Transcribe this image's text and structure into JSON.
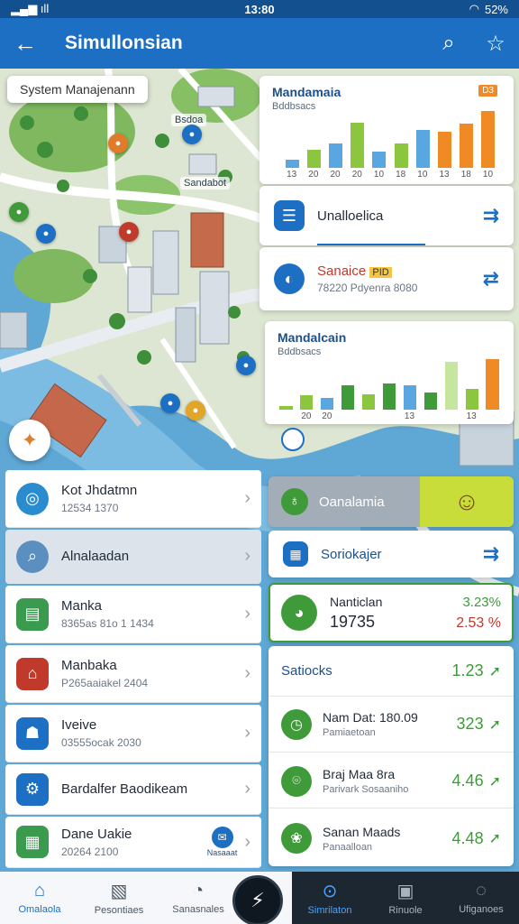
{
  "status": {
    "time": "13:80",
    "battery": "52%",
    "left_icons": "▂▄▆ ıll"
  },
  "appbar": {
    "title": "Simullonsian"
  },
  "map": {
    "tooltip": "System Manajenann",
    "labels": [
      "Bsdoa",
      "Sandabot"
    ]
  },
  "chart_top": {
    "title": "Mandamaia",
    "subtitle": "Bddbsacs",
    "badge": "D3"
  },
  "row_top_1": {
    "label": "Unalloelica"
  },
  "row_top_2": {
    "label": "Sanaice",
    "tag": "PID",
    "sub": "78220 Pdyenra 8080"
  },
  "chart_mid": {
    "title": "Mandalcain",
    "subtitle": "Bddbsacs"
  },
  "left_list": [
    {
      "title": "Kot Jhdatmn",
      "sub": "12534 1370",
      "color": "#2a8ccf",
      "icon": "◎"
    },
    {
      "title": "Alnalaadan",
      "sub": "",
      "color": "#5a8fbf",
      "icon": "⌕"
    },
    {
      "title": "Manka",
      "sub": "8365as 81o 1 1434",
      "color": "#3a9b4f",
      "icon": "▤"
    },
    {
      "title": "Manbaka",
      "sub": "P265aaiakel 2404",
      "color": "#c0392b",
      "icon": "⌂"
    },
    {
      "title": "Iveive",
      "sub": "03555ocak 2030",
      "color": "#1d6fc4",
      "icon": "☗"
    },
    {
      "title": "Bardalfer Baodikeam",
      "sub": "",
      "color": "#1d6fc4",
      "icon": "⚙"
    },
    {
      "title": "Dane Uakie",
      "sub": "20264 2100",
      "color": "#3a9b4f",
      "icon": "▦",
      "extra": "Nasaaat"
    }
  ],
  "right_panel": {
    "header": {
      "label": "Oanalamia"
    },
    "tab": {
      "label": "Soriokajer"
    },
    "summary": {
      "label": "Nanticlan",
      "value": "19735",
      "pct_green": "3.23%",
      "pct_red": "2.53 %"
    },
    "stats_title": "Satiocks",
    "stats_title_val": "1.23",
    "stats": [
      {
        "title": "Nam Dat: 180.09",
        "sub": "Pamiaetoan",
        "value": "323"
      },
      {
        "title": "Braj Maa 8ra",
        "sub": "Parivark Sosaaniho",
        "value": "4.46"
      },
      {
        "title": "Sanan Maads",
        "sub": "Panaalloan",
        "value": "4.48"
      }
    ]
  },
  "bottom_nav": [
    {
      "label": "Omalaola",
      "icon": "⌂",
      "active": true
    },
    {
      "label": "Pesontiaes",
      "icon": "▧",
      "active": false
    },
    {
      "label": "Sanasnales",
      "icon": "◔",
      "active": false
    },
    {
      "label": "Simrilaton",
      "icon": "⊙",
      "active": true
    },
    {
      "label": "Rinuole",
      "icon": "▣",
      "active": false
    },
    {
      "label": "Ufiganoes",
      "icon": "◌",
      "active": false
    }
  ],
  "colors": {
    "appbar": "#1d6fc4",
    "green": "#3f9a3a",
    "orange": "#f08a24",
    "blue_bar": "#5aa6e0",
    "lime": "#8cc63f"
  },
  "chart_data": [
    {
      "type": "bar",
      "title": "Mandamaia",
      "categories": [
        "13",
        "20",
        "20",
        "20",
        "10",
        "18",
        "10",
        "13",
        "18",
        "10"
      ],
      "values": [
        13,
        28,
        38,
        70,
        25,
        38,
        58,
        55,
        68,
        88
      ],
      "ylim": [
        0,
        100
      ]
    },
    {
      "type": "bar",
      "title": "Mandalcain",
      "categories": [
        "",
        "20",
        "20",
        "",
        "",
        "",
        "13",
        "",
        "",
        "13"
      ],
      "values": [
        6,
        22,
        18,
        38,
        24,
        40,
        38,
        26,
        74,
        32,
        78
      ],
      "ylim": [
        0,
        100
      ]
    }
  ]
}
